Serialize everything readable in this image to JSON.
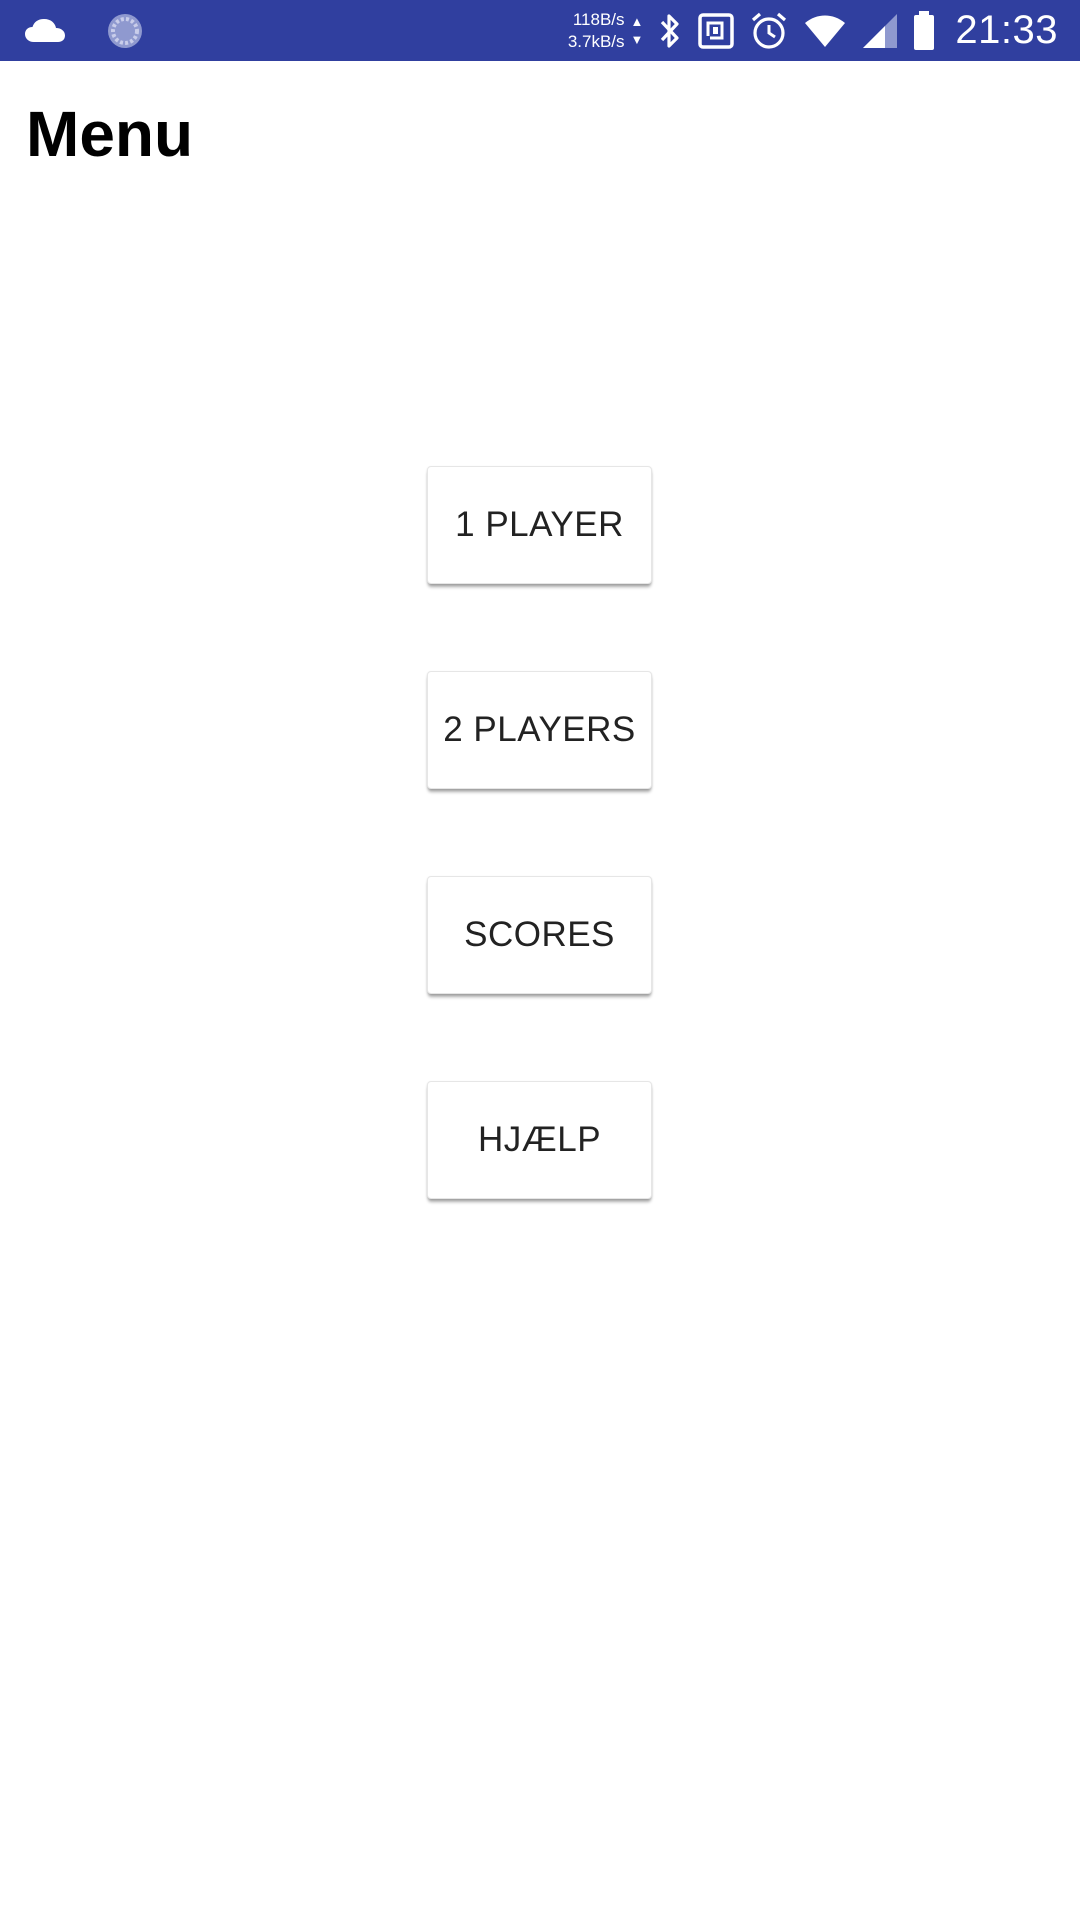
{
  "status_bar": {
    "left_icons": [
      "cloud-icon",
      "sync-icon"
    ],
    "net_speed_up": "118B/s",
    "net_speed_down": "3.7kB/s",
    "right_icons": [
      "bluetooth-icon",
      "nfc-icon",
      "alarm-icon",
      "wifi-icon",
      "signal-icon",
      "battery-icon"
    ],
    "time": "21:33",
    "background_color": "#303f9f"
  },
  "page": {
    "title": "Menu"
  },
  "menu": {
    "buttons": [
      {
        "label": "1 PLAYER"
      },
      {
        "label": "2 PLAYERS"
      },
      {
        "label": "SCORES"
      },
      {
        "label": "HJÆLP"
      }
    ]
  }
}
